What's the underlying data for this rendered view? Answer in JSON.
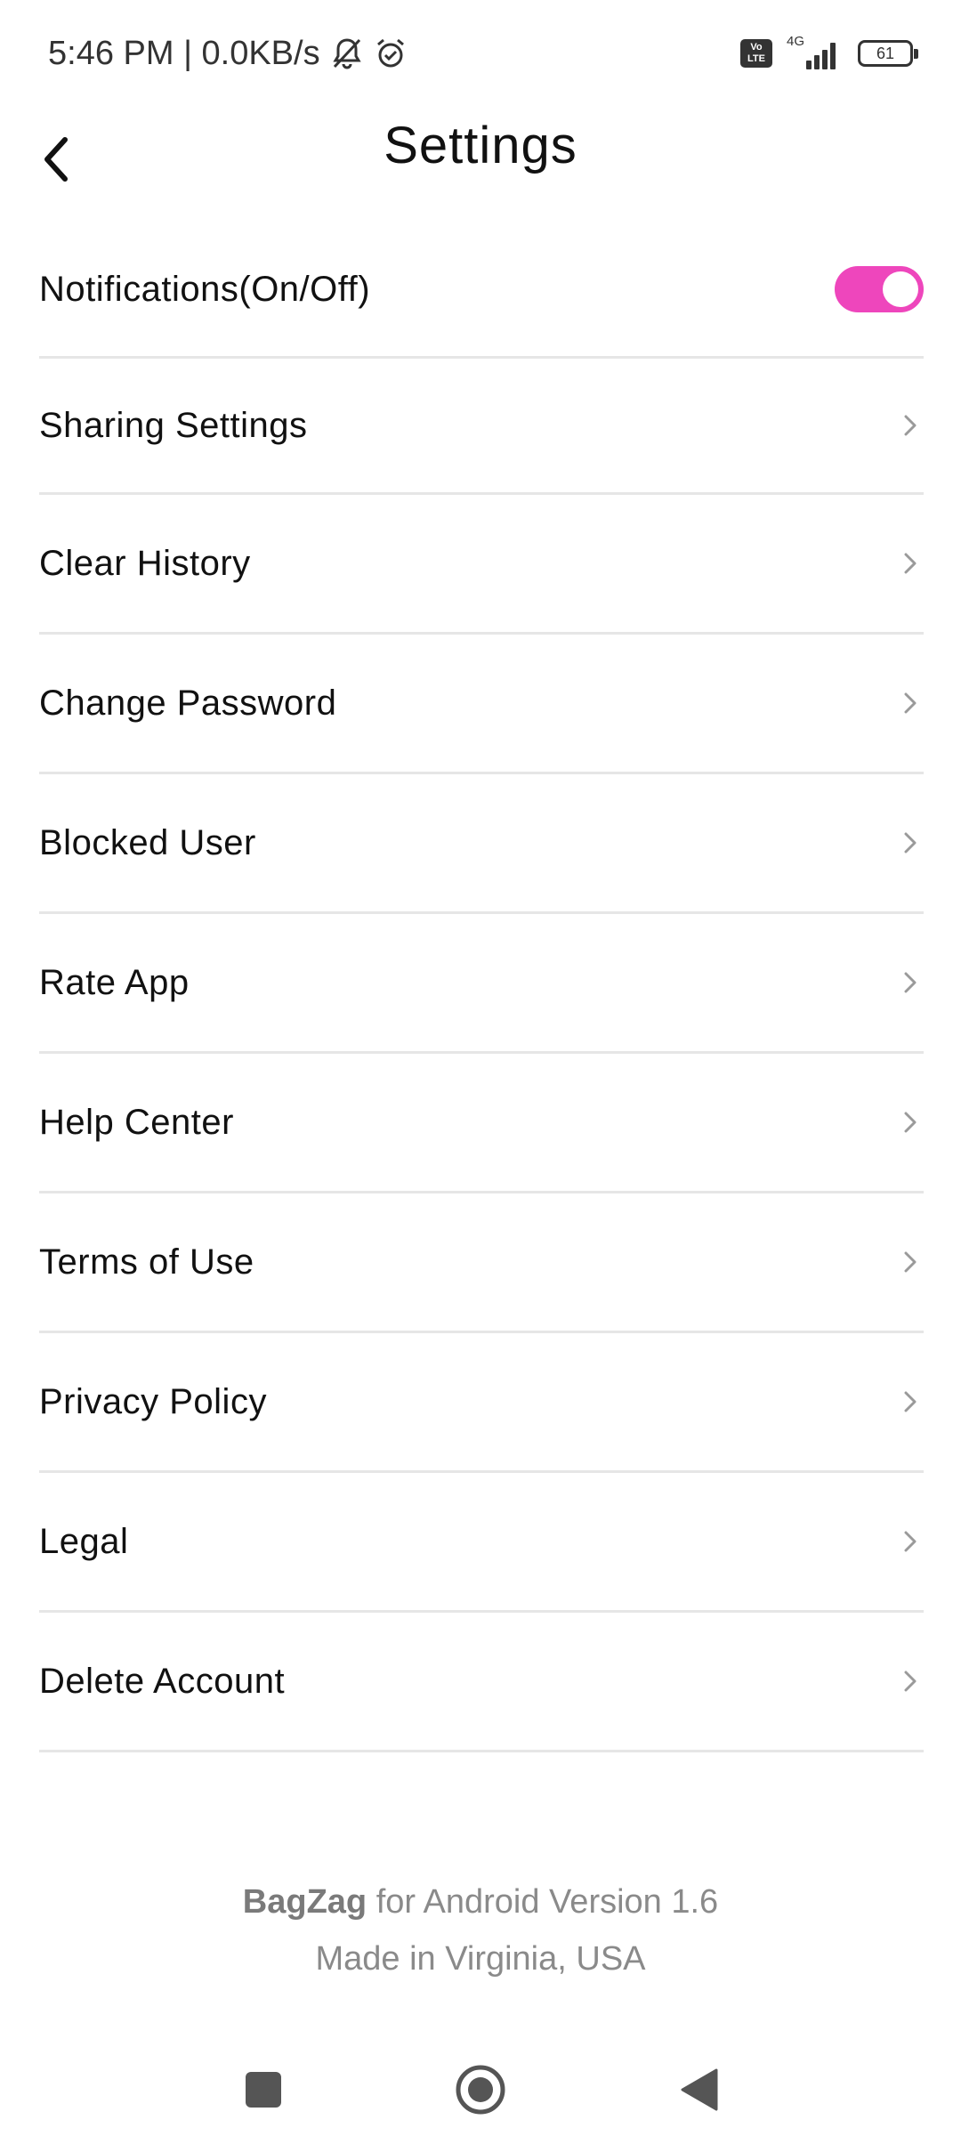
{
  "status_bar": {
    "time_speed": "5:46 PM | 0.0KB/s",
    "volte": "Vo LTE",
    "network": "4G",
    "battery": "61"
  },
  "header": {
    "title": "Settings"
  },
  "settings": {
    "notifications": {
      "label": "Notifications(On/Off)",
      "enabled": true
    },
    "items": [
      {
        "label": "Sharing Settings"
      },
      {
        "label": "Clear History"
      },
      {
        "label": "Change Password"
      },
      {
        "label": "Blocked User"
      },
      {
        "label": "Rate App"
      },
      {
        "label": "Help Center"
      },
      {
        "label": "Terms of Use"
      },
      {
        "label": "Privacy Policy"
      },
      {
        "label": "Legal"
      },
      {
        "label": "Delete Account"
      }
    ]
  },
  "footer": {
    "brand": "BagZag",
    "version_text": "for Android Version 1.6",
    "made_in": "Made in Virginia, USA"
  },
  "colors": {
    "accent": "#ee46bc",
    "divider": "#e6e6e6",
    "chevron": "#9a9a9a"
  },
  "icons": {
    "back": "chevron-left-icon",
    "row": "chevron-right-icon",
    "nav_recents": "square-icon",
    "nav_home": "circle-icon",
    "nav_back": "triangle-icon"
  }
}
